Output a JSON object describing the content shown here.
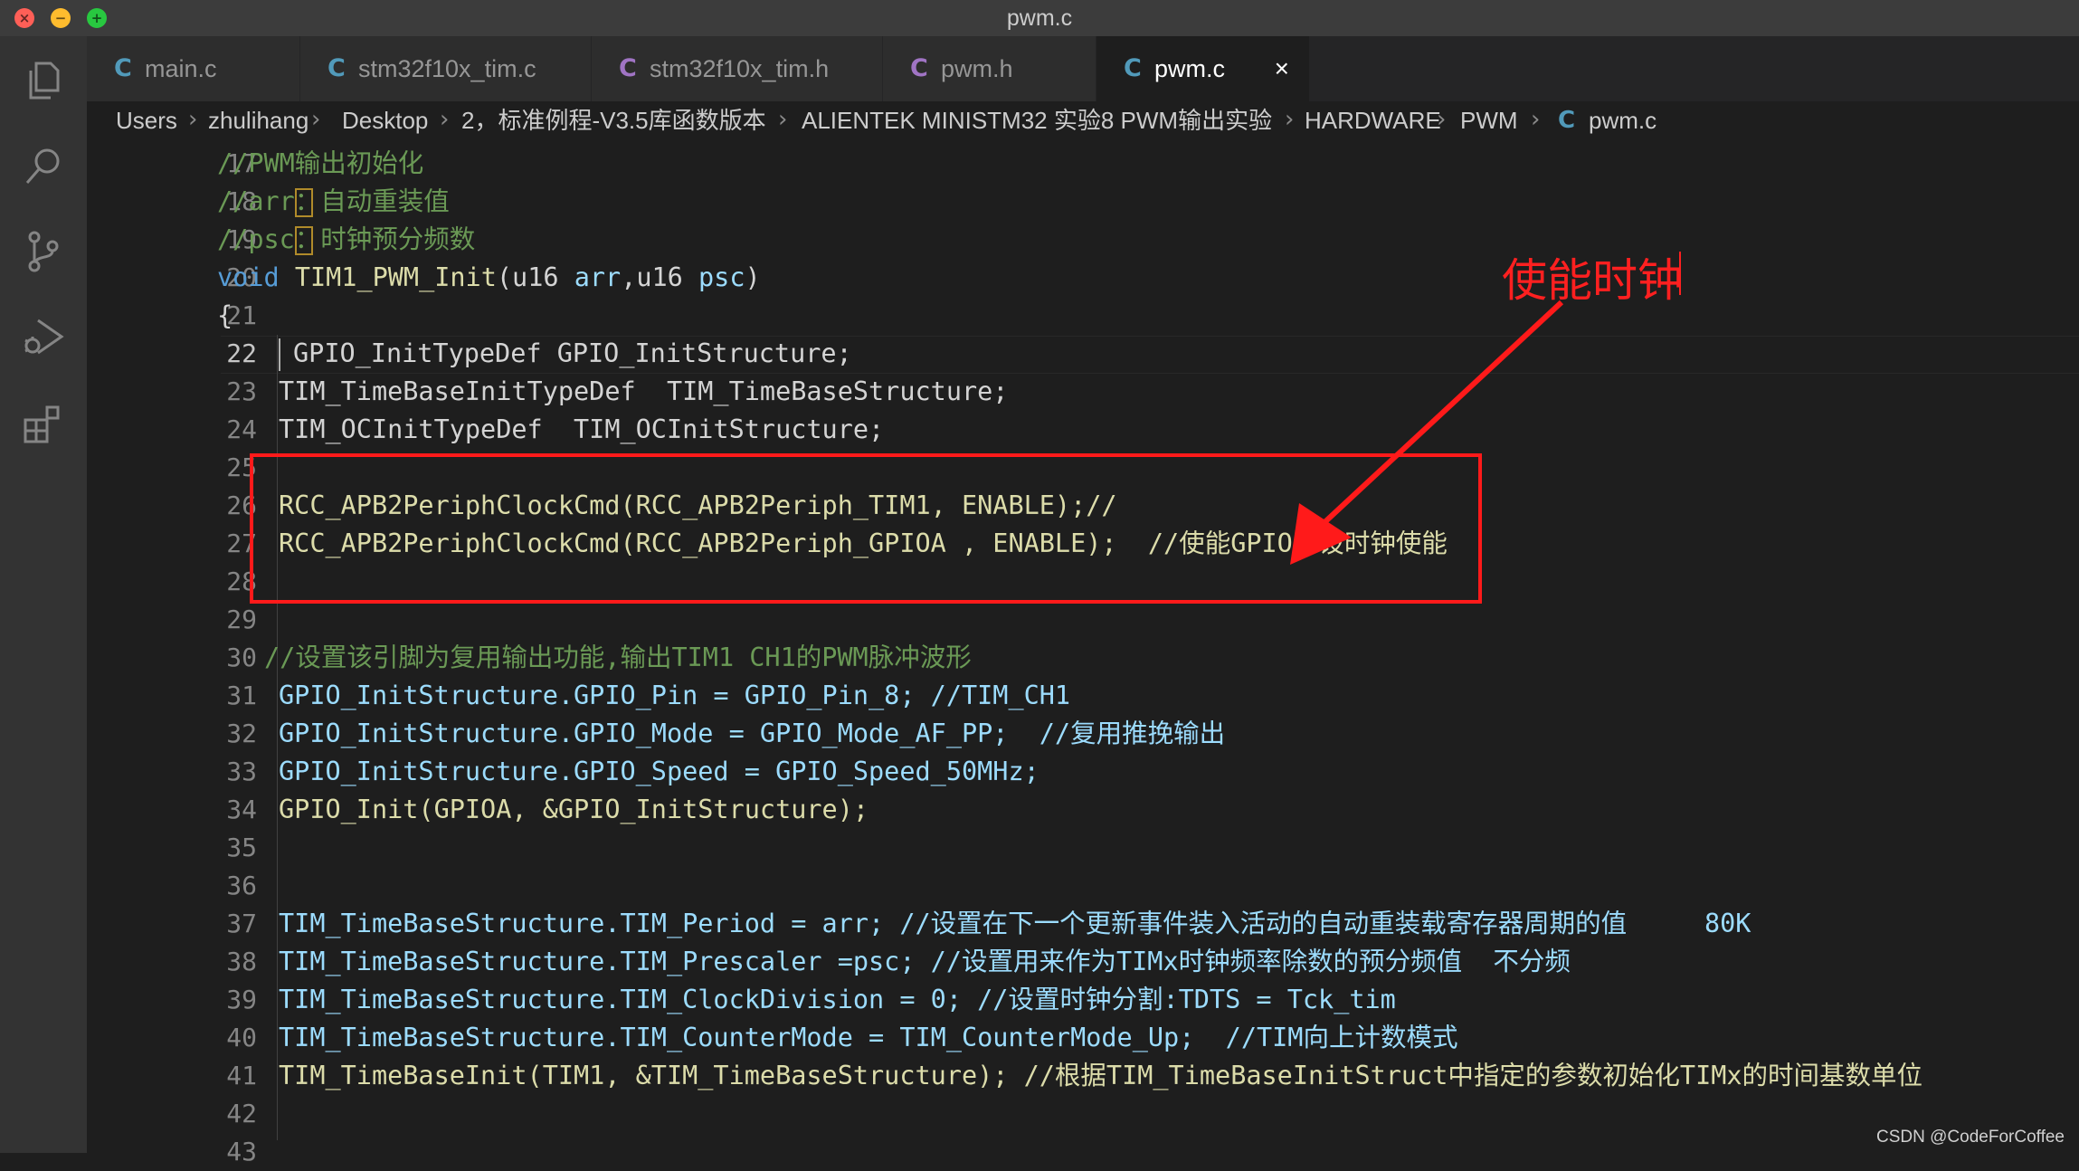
{
  "window": {
    "title": "pwm.c",
    "close_glyph": "×",
    "min_glyph": "−",
    "max_glyph": "+"
  },
  "activity_icons": [
    "explorer-icon",
    "search-icon",
    "source-control-icon",
    "run-debug-icon",
    "extensions-icon"
  ],
  "tabs": [
    {
      "label": "main.c",
      "icon": "C",
      "icon_color": "#519aba",
      "active": false
    },
    {
      "label": "stm32f10x_tim.c",
      "icon": "C",
      "icon_color": "#519aba",
      "active": false
    },
    {
      "label": "stm32f10x_tim.h",
      "icon": "C",
      "icon_color": "#a074c4",
      "active": false
    },
    {
      "label": "pwm.h",
      "icon": "C",
      "icon_color": "#a074c4",
      "active": false
    },
    {
      "label": "pwm.c",
      "icon": "C",
      "icon_color": "#519aba",
      "active": true,
      "close": "×"
    }
  ],
  "breadcrumb": {
    "items": [
      "Users",
      "zhulihang",
      "Desktop",
      "2，标准例程-V3.5库函数版本",
      "ALIENTEK MINISTM32 实验8 PWM输出实验",
      "HARDWARE",
      "PWM"
    ],
    "file_icon": "C",
    "file": "pwm.c",
    "separator": "›"
  },
  "code_lines": [
    {
      "n": "17",
      "text": "//PWM输出初始化"
    },
    {
      "n": "18",
      "text": "//arr：自动重装值"
    },
    {
      "n": "19",
      "text": "//psc：时钟预分频数"
    },
    {
      "n": "20",
      "text": "void TIM1_PWM_Init(u16 arr,u16 psc)"
    },
    {
      "n": "21",
      "text": "{"
    },
    {
      "n": "22",
      "text": "GPIO_InitTypeDef GPIO_InitStructure;"
    },
    {
      "n": "23",
      "text": "TIM_TimeBaseInitTypeDef  TIM_TimeBaseStructure;"
    },
    {
      "n": "24",
      "text": "TIM_OCInitTypeDef  TIM_OCInitStructure;"
    },
    {
      "n": "25",
      "text": ""
    },
    {
      "n": "26",
      "text": "RCC_APB2PeriphClockCmd(RCC_APB2Periph_TIM1, ENABLE);//"
    },
    {
      "n": "27",
      "text": "RCC_APB2PeriphClockCmd(RCC_APB2Periph_GPIOA , ENABLE);  //使能GPIO外设时钟使能"
    },
    {
      "n": "28",
      "text": ""
    },
    {
      "n": "29",
      "text": ""
    },
    {
      "n": "30",
      "text": "//设置该引脚为复用输出功能,输出TIM1 CH1的PWM脉冲波形"
    },
    {
      "n": "31",
      "text": "GPIO_InitStructure.GPIO_Pin = GPIO_Pin_8; //TIM_CH1"
    },
    {
      "n": "32",
      "text": "GPIO_InitStructure.GPIO_Mode = GPIO_Mode_AF_PP;  //复用推挽输出"
    },
    {
      "n": "33",
      "text": "GPIO_InitStructure.GPIO_Speed = GPIO_Speed_50MHz;"
    },
    {
      "n": "34",
      "text": "GPIO_Init(GPIOA, &GPIO_InitStructure);"
    },
    {
      "n": "35",
      "text": ""
    },
    {
      "n": "36",
      "text": ""
    },
    {
      "n": "37",
      "text": "TIM_TimeBaseStructure.TIM_Period = arr; //设置在下一个更新事件装入活动的自动重装载寄存器周期的值     80K"
    },
    {
      "n": "38",
      "text": "TIM_TimeBaseStructure.TIM_Prescaler =psc; //设置用来作为TIMx时钟频率除数的预分频值  不分频"
    },
    {
      "n": "39",
      "text": "TIM_TimeBaseStructure.TIM_ClockDivision = 0; //设置时钟分割:TDTS = Tck_tim"
    },
    {
      "n": "40",
      "text": "TIM_TimeBaseStructure.TIM_CounterMode = TIM_CounterMode_Up;  //TIM向上计数模式"
    },
    {
      "n": "41",
      "text": "TIM_TimeBaseInit(TIM1, &TIM_TimeBaseStructure); //根据TIM_TimeBaseInitStruct中指定的参数初始化TIMx的时间基数单位"
    },
    {
      "n": "42",
      "text": ""
    },
    {
      "n": "43",
      "text": ""
    }
  ],
  "current_line": "22",
  "annotation": {
    "text": "使能时钟",
    "color": "#ff2020"
  },
  "watermark": "CSDN @CodeForCoffee"
}
